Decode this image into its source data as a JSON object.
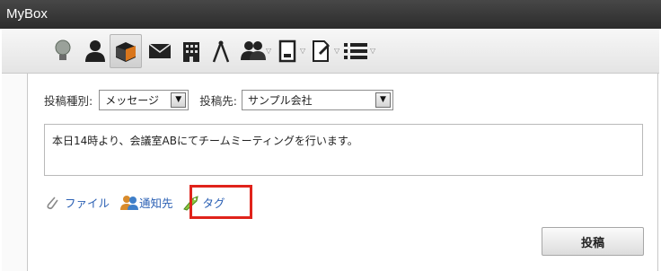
{
  "window": {
    "title": "MyBox"
  },
  "toolbar": {
    "icons": [
      {
        "name": "lightbulb-icon",
        "glyph": "💡"
      },
      {
        "name": "person-icon",
        "glyph": "👤"
      },
      {
        "name": "box-icon",
        "glyph": "📦"
      },
      {
        "name": "mail-icon",
        "glyph": "✉"
      },
      {
        "name": "building-icon",
        "glyph": "🏢"
      },
      {
        "name": "compass-icon",
        "glyph": "⋀"
      },
      {
        "name": "group-icon",
        "glyph": "👥"
      },
      {
        "name": "document-icon",
        "glyph": "▯"
      },
      {
        "name": "edit-document-icon",
        "glyph": "📝"
      },
      {
        "name": "list-icon",
        "glyph": "☰"
      }
    ]
  },
  "form": {
    "post_type_label": "投稿種別:",
    "post_type_value": "メッセージ",
    "post_to_label": "投稿先:",
    "post_to_value": "サンプル会社",
    "message_text": "本日14時より、会議室ABにてチームミーティングを行います。",
    "file_link": "ファイル",
    "notify_link": "通知先",
    "tag_link": "タグ",
    "post_button": "投稿"
  },
  "colors": {
    "titlebar": "#3a3a3a",
    "link": "#2b60b4",
    "highlight": "#e0231b"
  }
}
